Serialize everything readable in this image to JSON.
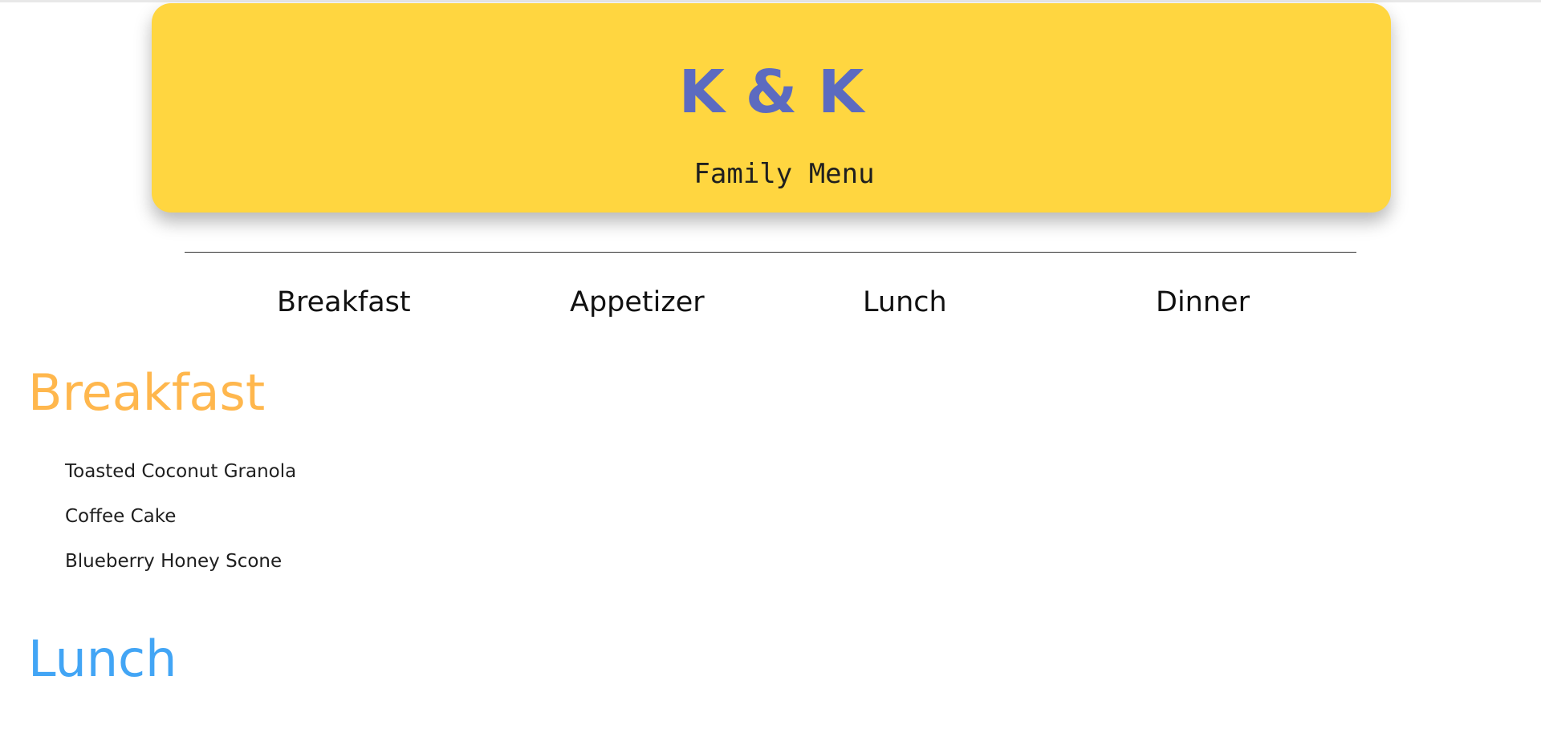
{
  "header": {
    "title": "K & K",
    "subtitle": "Family Menu"
  },
  "nav": {
    "items": [
      {
        "label": "Breakfast"
      },
      {
        "label": "Appetizer"
      },
      {
        "label": "Lunch"
      },
      {
        "label": "Dinner"
      }
    ]
  },
  "sections": [
    {
      "heading": "Breakfast",
      "color": "#ffb74d",
      "items": [
        "Toasted Coconut Granola",
        "Coffee Cake",
        "Blueberry Honey Scone"
      ]
    },
    {
      "heading": "Lunch",
      "color": "#42a5f5"
    }
  ],
  "colors": {
    "header_background": "#ffd640",
    "title": "#5c6bc0"
  }
}
